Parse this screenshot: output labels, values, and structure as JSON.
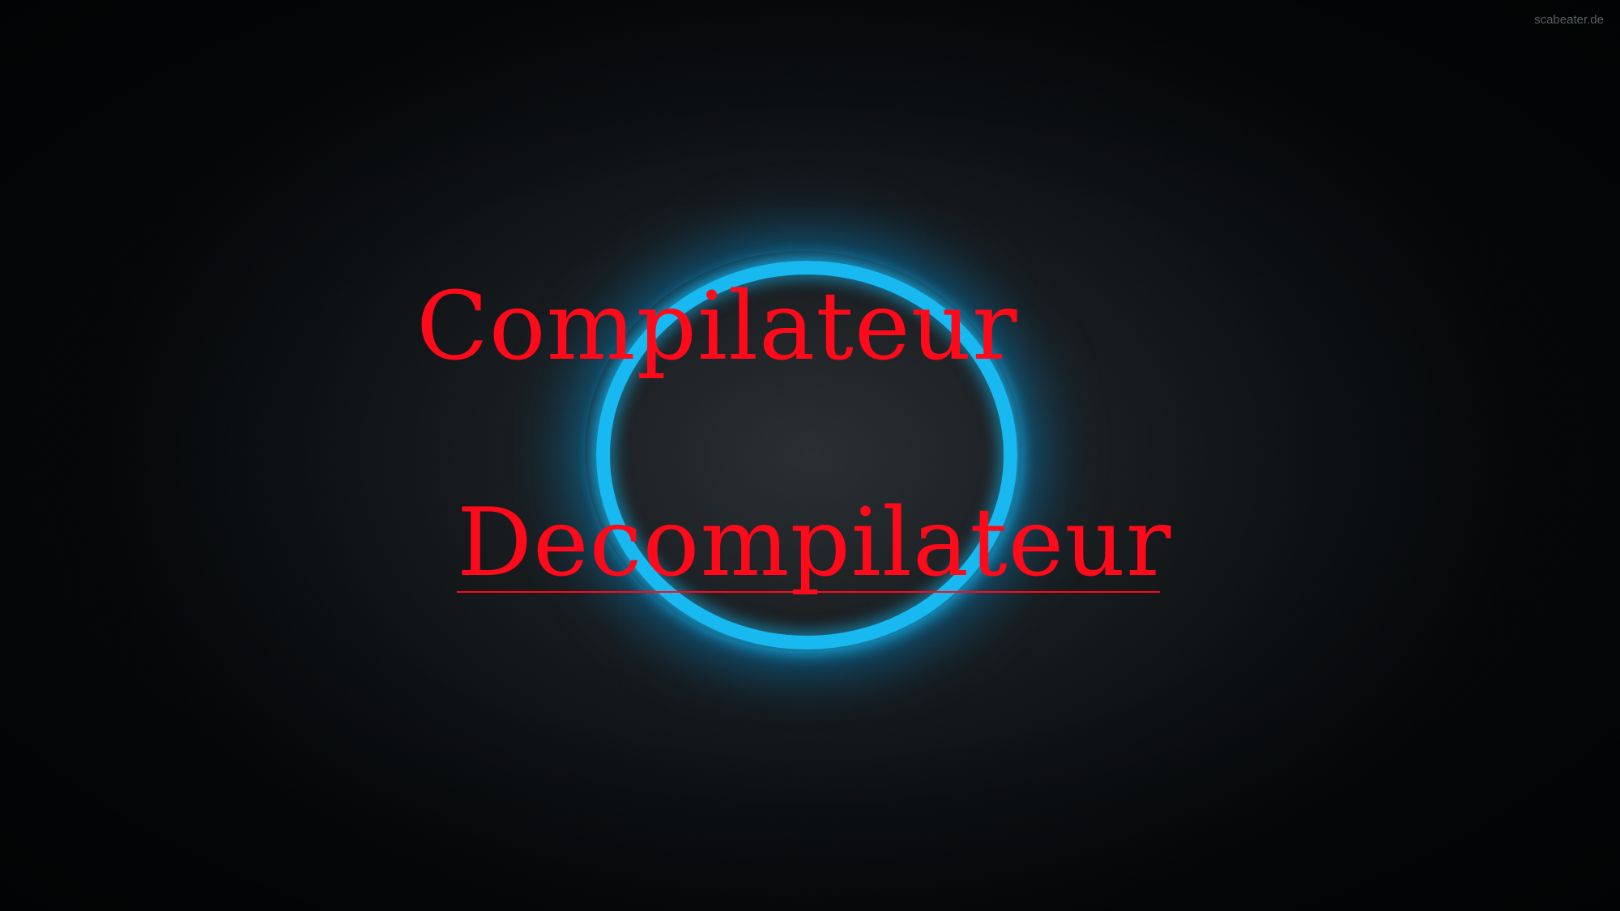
{
  "watermark": "scabeater.de",
  "menu": {
    "items": [
      {
        "label": "Compilateur",
        "underlined": false
      },
      {
        "label": "Decompilateur",
        "underlined": true
      }
    ]
  },
  "colors": {
    "text": "#ff0a1a",
    "ring": "#18b8f0",
    "background": "#0a0d10"
  },
  "icons": {
    "ring": "glowing-ring-icon"
  }
}
